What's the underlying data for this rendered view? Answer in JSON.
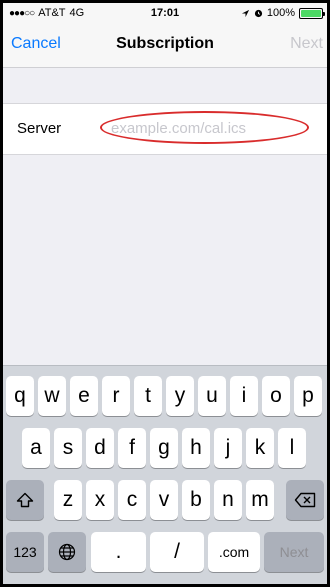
{
  "status_bar": {
    "carrier": "AT&T",
    "network": "4G",
    "time": "17:01",
    "battery": "100%",
    "battery_level": 1.0
  },
  "nav": {
    "cancel_label": "Cancel",
    "title": "Subscription",
    "next_label": "Next"
  },
  "form": {
    "server_label": "Server",
    "server_value": "",
    "server_placeholder": "example.com/cal.ics"
  },
  "keyboard": {
    "row1": [
      "q",
      "w",
      "e",
      "r",
      "t",
      "y",
      "u",
      "i",
      "o",
      "p"
    ],
    "row2": [
      "a",
      "s",
      "d",
      "f",
      "g",
      "h",
      "j",
      "k",
      "l"
    ],
    "row3": [
      "z",
      "x",
      "c",
      "v",
      "b",
      "n",
      "m"
    ],
    "bottom": {
      "numbers": "123",
      "dot": ".",
      "slash": "/",
      "dotcom": ".com",
      "next": "Next"
    }
  },
  "colors": {
    "accent": "#0a7aff",
    "disabled": "#c7c7cc",
    "highlight": "#d92c2c",
    "battery": "#4cd964"
  },
  "icons": {
    "location": "location-arrow-icon",
    "alarm": "alarm-icon",
    "shift": "shift-icon",
    "globe": "globe-icon",
    "delete": "backspace-icon"
  }
}
